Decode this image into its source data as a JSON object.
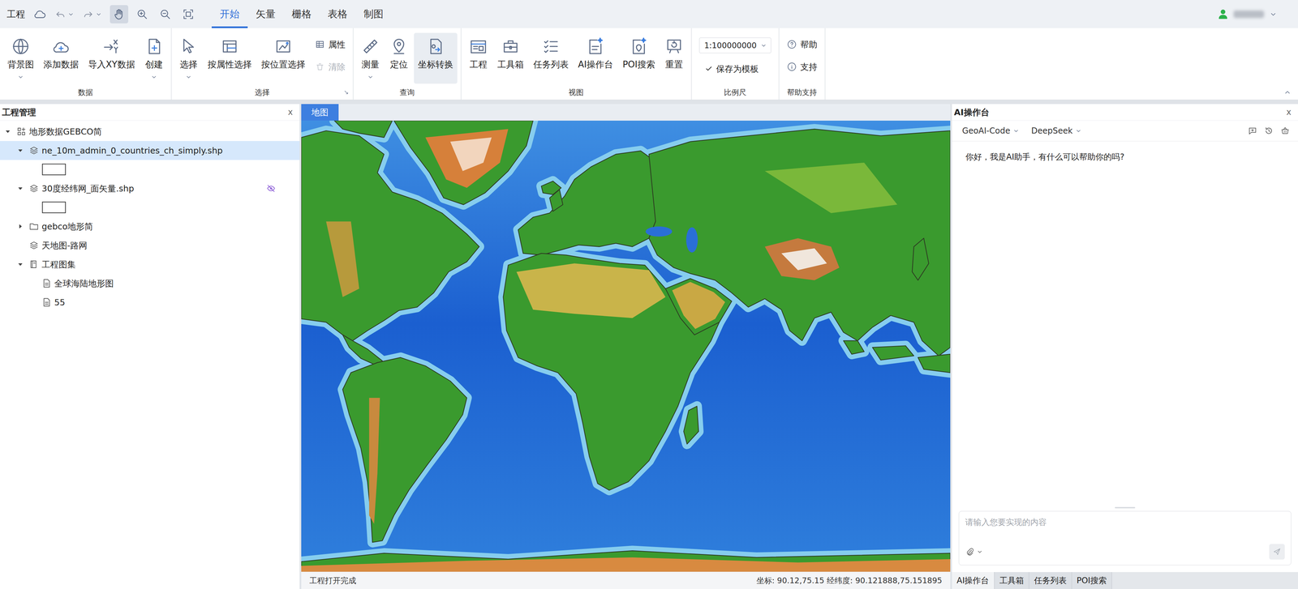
{
  "topbar": {
    "project_menu": "工程",
    "tools": [
      {
        "selected": true
      },
      {
        "selected": false
      },
      {
        "selected": false
      },
      {
        "selected": false
      }
    ],
    "tabs": [
      {
        "label": "开始",
        "selected": true
      },
      {
        "label": "矢量",
        "selected": false
      },
      {
        "label": "栅格",
        "selected": false
      },
      {
        "label": "表格",
        "selected": false
      },
      {
        "label": "制图",
        "selected": false
      }
    ]
  },
  "ribbon": {
    "groups": [
      {
        "label": "数据",
        "launcher": false,
        "items": [
          {
            "kind": "large",
            "label": "背景图",
            "dropdown": true,
            "selected": false,
            "disabled": false
          },
          {
            "kind": "large",
            "label": "添加数据",
            "dropdown": false,
            "selected": false,
            "disabled": false
          },
          {
            "kind": "large",
            "label": "导入XY数据",
            "dropdown": false,
            "selected": false,
            "disabled": false
          },
          {
            "kind": "large",
            "label": "创建",
            "dropdown": true,
            "selected": false,
            "disabled": false
          }
        ]
      },
      {
        "label": "选择",
        "launcher": true,
        "items": [
          {
            "kind": "large",
            "label": "选择",
            "dropdown": true,
            "selected": false,
            "disabled": false
          },
          {
            "kind": "large",
            "label": "按属性选择",
            "dropdown": false,
            "selected": false,
            "disabled": false
          },
          {
            "kind": "large",
            "label": "按位置选择",
            "dropdown": false,
            "selected": false,
            "disabled": false
          },
          {
            "kind": "small",
            "label": "属性",
            "dropdown": false,
            "selected": false,
            "disabled": false
          },
          {
            "kind": "small",
            "label": "清除",
            "dropdown": false,
            "selected": false,
            "disabled": true
          }
        ]
      },
      {
        "label": "查询",
        "launcher": false,
        "items": [
          {
            "kind": "large",
            "label": "测量",
            "dropdown": true,
            "selected": false,
            "disabled": false
          },
          {
            "kind": "large",
            "label": "定位",
            "dropdown": false,
            "selected": false,
            "disabled": false
          },
          {
            "kind": "large",
            "label": "坐标转换",
            "dropdown": false,
            "selected": true,
            "disabled": false
          }
        ]
      },
      {
        "label": "视图",
        "launcher": false,
        "items": [
          {
            "kind": "large",
            "label": "工程",
            "dropdown": false,
            "selected": false,
            "disabled": false
          },
          {
            "kind": "large",
            "label": "工具箱",
            "dropdown": false,
            "selected": false,
            "disabled": false
          },
          {
            "kind": "large",
            "label": "任务列表",
            "dropdown": false,
            "selected": false,
            "disabled": false
          },
          {
            "kind": "large",
            "label": "AI操作台",
            "dropdown": false,
            "selected": false,
            "disabled": false
          },
          {
            "kind": "large",
            "label": "POI搜索",
            "dropdown": false,
            "selected": false,
            "disabled": false
          },
          {
            "kind": "large",
            "label": "重置",
            "dropdown": false,
            "selected": false,
            "disabled": false
          }
        ]
      },
      {
        "label": "比例尺",
        "launcher": false,
        "items": [
          {
            "kind": "select",
            "label": "1:100000000",
            "dropdown": true,
            "selected": false,
            "disabled": false
          },
          {
            "kind": "check",
            "label": "保存为模板",
            "checked": true,
            "dropdown": false,
            "selected": false,
            "disabled": false
          }
        ]
      },
      {
        "label": "帮助支持",
        "launcher": false,
        "items": [
          {
            "kind": "small",
            "label": "帮助",
            "dropdown": false,
            "selected": false,
            "disabled": false
          },
          {
            "kind": "small",
            "label": "支持",
            "dropdown": false,
            "selected": false,
            "disabled": false
          }
        ]
      }
    ]
  },
  "project_panel": {
    "title": "工程管理",
    "close": "x",
    "tree": [
      {
        "label": "地形数据GEBCO简",
        "level": 0,
        "kind": "project",
        "expandable": true,
        "expanded": true,
        "selected": false,
        "hidden": false
      },
      {
        "label": "ne_10m_admin_0_countries_ch_simply.shp",
        "level": 1,
        "kind": "layer",
        "expandable": true,
        "expanded": true,
        "selected": true,
        "hidden": false
      },
      {
        "level": 2,
        "kind": "legend",
        "expandable": false,
        "expanded": false,
        "selected": false,
        "hidden": false
      },
      {
        "label": "30度经纬网_面矢量.shp",
        "level": 1,
        "kind": "layer",
        "expandable": true,
        "expanded": true,
        "selected": false,
        "hidden": true
      },
      {
        "level": 2,
        "kind": "legend",
        "expandable": false,
        "expanded": false,
        "selected": false,
        "hidden": false
      },
      {
        "label": "gebco地形简",
        "level": 1,
        "kind": "folder",
        "expandable": true,
        "expanded": false,
        "selected": false,
        "hidden": false
      },
      {
        "label": "天地图-路网",
        "level": 1,
        "kind": "layer",
        "expandable": false,
        "expanded": false,
        "selected": false,
        "hidden": false
      },
      {
        "label": "工程图集",
        "level": 1,
        "kind": "atlas",
        "expandable": true,
        "expanded": true,
        "selected": false,
        "hidden": false
      },
      {
        "label": "全球海陆地形图",
        "level": 2,
        "kind": "map",
        "expandable": false,
        "expanded": false,
        "selected": false,
        "hidden": false
      },
      {
        "label": "55",
        "level": 2,
        "kind": "map",
        "expandable": false,
        "expanded": false,
        "selected": false,
        "hidden": false
      }
    ]
  },
  "map_panel": {
    "tabs": [
      {
        "label": "地图",
        "selected": true
      }
    ],
    "status": "工程打开完成",
    "coords": "坐标: 90.12,75.15 经纬度: 90.121888,75.151895"
  },
  "ai_panel": {
    "title": "AI操作台",
    "close": "x",
    "mode": "GeoAI-Code",
    "model": "DeepSeek",
    "messages": [
      "你好，我是AI助手，有什么可以帮助你的吗?"
    ],
    "input_placeholder": "请输入您要实现的内容"
  },
  "bottom_tabs": [
    {
      "label": "AI操作台",
      "selected": true
    },
    {
      "label": "工具箱",
      "selected": false
    },
    {
      "label": "任务列表",
      "selected": false
    },
    {
      "label": "POI搜索",
      "selected": false
    }
  ]
}
